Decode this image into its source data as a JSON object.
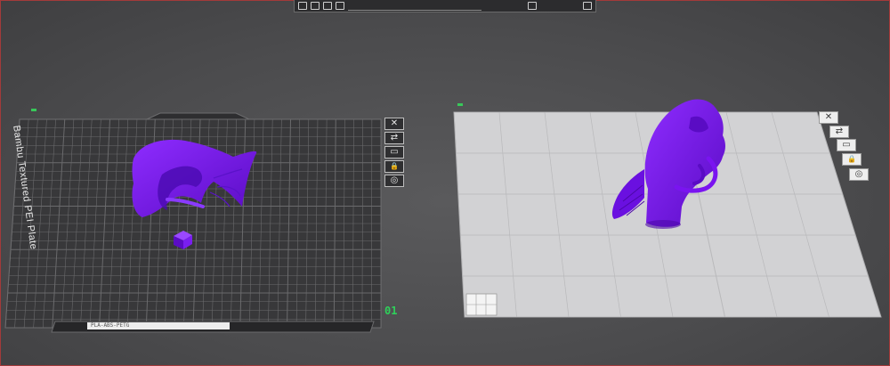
{
  "window": {
    "accent_border": "#a33a3a",
    "background": "#4f4f51"
  },
  "toolbar": {
    "icons": [
      "add-icon",
      "layout-icon",
      "arrange-icon",
      "orient-icon"
    ],
    "right_icons": [
      "measure-icon",
      "split-view-icon"
    ]
  },
  "plates": [
    {
      "id": "plate-1",
      "number": "01",
      "name": "Bambu Textured PEI Plate",
      "bottom_label": "PLA-ABS-PETG",
      "type": "textured-dark",
      "objects": [
        "betta-fish-model",
        "small-cube"
      ]
    },
    {
      "id": "plate-2",
      "number": "",
      "type": "smooth-light",
      "objects": [
        "betta-fish-model-upright"
      ]
    }
  ],
  "plate_buttons": [
    {
      "icon": "close-icon",
      "glyph": "✕"
    },
    {
      "icon": "auto-arrange-icon",
      "glyph": "⇄"
    },
    {
      "icon": "orient-plate-icon",
      "glyph": "▭"
    },
    {
      "icon": "lock-icon",
      "glyph": "🔒"
    },
    {
      "icon": "settings-icon",
      "glyph": "◎"
    }
  ],
  "colors": {
    "model": "#7a14f0",
    "model_shadow": "#4c08a8",
    "dark_plate": "#3a3a3c",
    "light_plate": "#cfcfd1",
    "grid_line": "#7a7a7c",
    "plate_number": "#2fd05a"
  }
}
